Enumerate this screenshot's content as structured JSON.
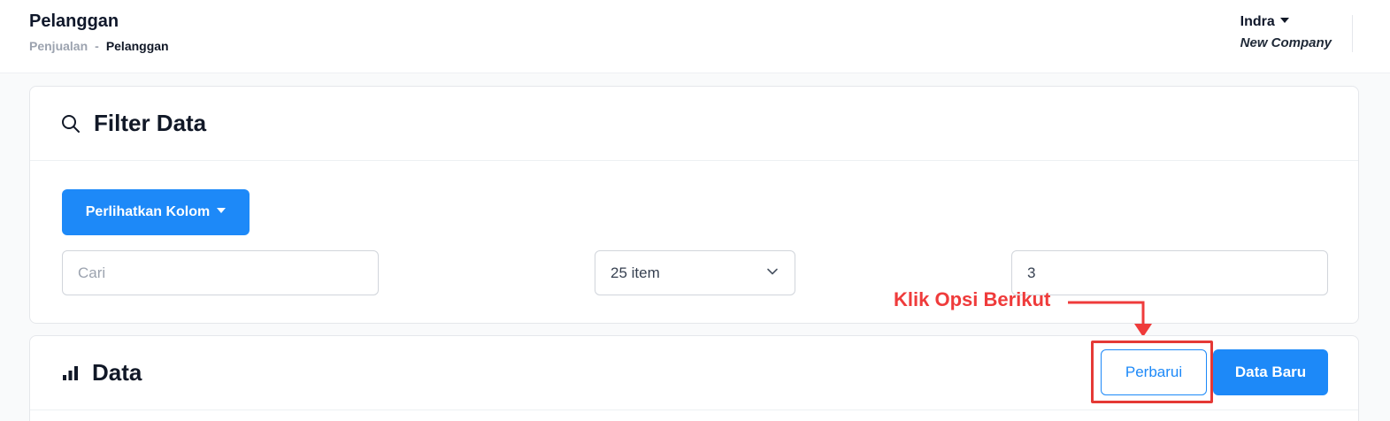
{
  "header": {
    "title": "Pelanggan",
    "breadcrumb": {
      "parent": "Penjualan",
      "separator": "-",
      "current": "Pelanggan"
    },
    "user": {
      "name": "Indra",
      "company": "New Company"
    }
  },
  "filter": {
    "title": "Filter Data",
    "icon": "search-icon",
    "columns_button": "Perlihatkan Kolom",
    "search": {
      "value": "",
      "placeholder": "Cari"
    },
    "page_size": {
      "selected": "25 item"
    },
    "page_number": {
      "value": "3"
    }
  },
  "annotation": {
    "text": "Klik Opsi Berikut",
    "color": "#ef3b3b"
  },
  "data_section": {
    "title": "Data",
    "icon": "bar-chart-icon",
    "refresh_button": "Perbarui",
    "new_button": "Data Baru"
  },
  "colors": {
    "primary": "#1d89f8",
    "highlight": "#e53935"
  }
}
